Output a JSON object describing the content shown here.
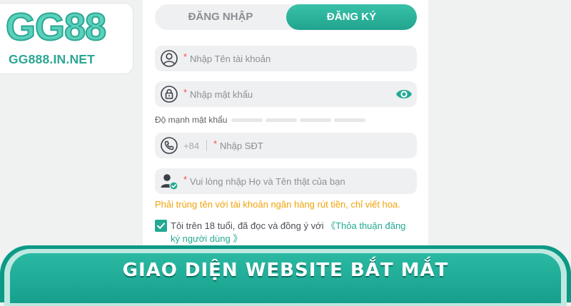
{
  "logo": {
    "name": "GG88",
    "url": "GG888.IN.NET"
  },
  "tabs": {
    "login": "ĐĂNG NHẬP",
    "register": "ĐĂNG KÝ"
  },
  "form": {
    "username_placeholder": "Nhập Tên tài khoản",
    "password_placeholder": "Nhập mật khẩu",
    "strength_label": "Độ mạnh mật khẩu",
    "phone_prefix": "+84",
    "phone_placeholder": "Nhập SĐT",
    "fullname_placeholder": "Vui lòng nhập Họ và Tên thật của bạn",
    "required_mark": "*",
    "name_hint": "Phải trùng tên với tài khoản ngân hàng rút tiền, chỉ viết hoa.",
    "agree_text": "Tôi trên 18 tuổi, đã đọc và đồng ý với ",
    "agree_link": "《Thỏa thuận đăng ký người dùng 》",
    "agree_checked": true
  },
  "banner": {
    "text": "GIAO DIỆN WEBSITE BẮT MẮT"
  },
  "colors": {
    "accent": "#22a993",
    "warning": "#f0a30a",
    "required": "#ff4d4f",
    "field_bg": "#eef0f1"
  },
  "icons": [
    "user-icon",
    "lock-icon",
    "eye-icon",
    "phone-icon",
    "user-check-icon",
    "checkmark-icon"
  ]
}
